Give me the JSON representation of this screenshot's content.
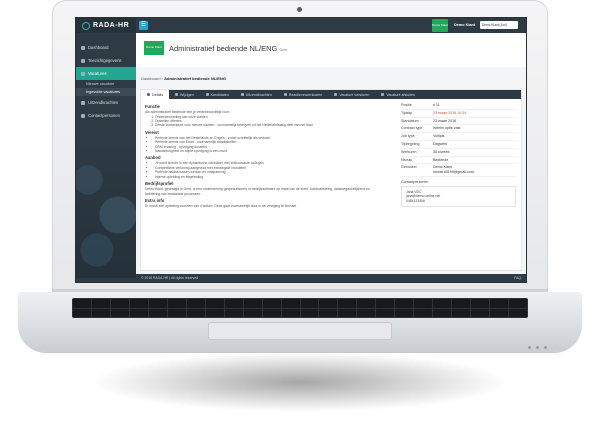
{
  "app": {
    "brand": "RADA-HR"
  },
  "topbar": {
    "menu_icon": "☰",
    "user_button": "Demo Klant",
    "user_name": "Demo Klant",
    "user_select": "Demo Klant (Jorl)"
  },
  "sidebar": {
    "items": [
      {
        "label": "Dashboard"
      },
      {
        "label": "Toezichtgegevens"
      },
      {
        "label": "Vacatures"
      },
      {
        "label": "Uitzendkrachten"
      },
      {
        "label": "Contactpersonen"
      }
    ],
    "sub_items": [
      {
        "label": "Nieuwe vacature"
      },
      {
        "label": "Ingevulde vacatures"
      }
    ]
  },
  "header": {
    "tag": "Demo Klant",
    "title": "Administratief bediende NL/ENG",
    "title_suffix": "Gent"
  },
  "breadcrumb": {
    "root": "Dashboard",
    "current": "Administratief bediende NL/ENG"
  },
  "tabs": [
    {
      "label": "Details"
    },
    {
      "label": "Wijzigen"
    },
    {
      "label": "Kandidaten"
    },
    {
      "label": "Uitzendkrachten"
    },
    {
      "label": "Reactieverwerkosten"
    },
    {
      "label": "Vacature versturen"
    },
    {
      "label": "Vacature afsluiten"
    }
  ],
  "content": {
    "functie_title": "Functie",
    "functie_text": "Als administratief bediende ben je verantwoordelijk voor:",
    "functie_list": [
      "Ondersteuneding van onze klanten",
      "Opstellen offertes",
      "Eerste contactpunt voor nieuwe klanten - voornamelijk bedrijven uit het Nederlandstalig deel van het land"
    ],
    "vereist_title": "Vereist",
    "vereist_list": [
      "Perfecte kennis van het Nederlands en Engels - zowel schriftelijk als verbaal",
      "Perfecte kennis van Excel - voornamelijk draaitabellen",
      "CRM ervaring - opvolging dossiers",
      "Nauwkeurigheid en stipte opvolging is een must"
    ],
    "aanbod_title": "Aanbod",
    "aanbod_list": [
      "Je komt terecht in een dynamische werksfeer met enthousiaste collega's",
      "Competitieve verloning aangevuld met extralegale voordelen",
      "Perfecte balans tussen werken en ontspanning",
      "Interne opleiding en begeleiding"
    ],
    "bedrijf_title": "Bedrijfsprofiel",
    "bedrijf_text": "Demo Klant, gevestigd in Gent, is een onderneming gespecialiseerd in bedrijfssoftware op maat van de klant. Automatisering, datatoegankelijkheid en facilitering van bestaande processen.",
    "extra_title": "Extra info",
    "extra_text": "Er wordt een opleiding voorzien van 4 weken. Deze gaat voornamelijk door in de vestiging te Brussel."
  },
  "details": [
    {
      "key": "Positie",
      "value": "# 11",
      "red": false
    },
    {
      "key": "Tijdstip",
      "value": "23 maart 2018 10:34",
      "red": true
    },
    {
      "key": "Startdatum",
      "value": "23 maart 2018",
      "red": false
    },
    {
      "key": "Contract type",
      "value": "Interim optie vast",
      "red": false
    },
    {
      "key": "Job type",
      "value": "Voltijds",
      "red": false
    },
    {
      "key": "Tijdregeling",
      "value": "Dagwerk",
      "red": false
    },
    {
      "key": "Werkuren",
      "value": "38 u/week",
      "red": false
    },
    {
      "key": "Niveau",
      "value": "Bediende",
      "red": false
    },
    {
      "key": "Gebruiker",
      "value": "Demo Klant",
      "red": false
    }
  ],
  "gebruiker_email": "lonnat.d0199@gmail.com",
  "contact": {
    "label": "Contactpersonen",
    "name": "Jana VDC",
    "email": "jana@demo-online.net",
    "phone": "0484123456"
  },
  "footer": {
    "left": "© 2018 RADA-HR | All rights reserved",
    "right": "FAQ"
  }
}
